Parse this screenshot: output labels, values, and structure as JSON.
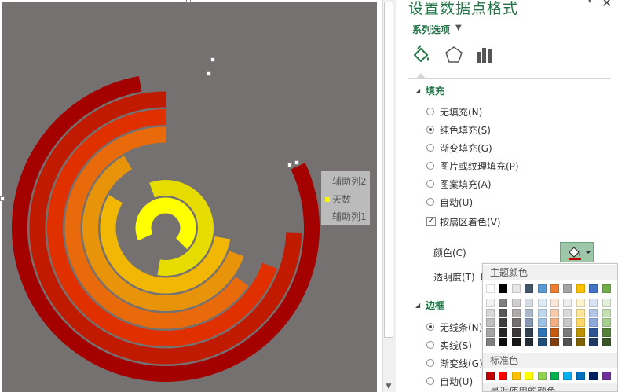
{
  "pane": {
    "title": "设置数据点格式",
    "series_options": "系列选项",
    "tabs": [
      "fill-line-icon",
      "effects-icon",
      "series-options-icon"
    ],
    "fill_section": "填充",
    "fill_options": [
      {
        "label": "无填充(N)",
        "selected": false
      },
      {
        "label": "纯色填充(S)",
        "selected": true
      },
      {
        "label": "渐变填充(G)",
        "selected": false
      },
      {
        "label": "图片或纹理填充(P)",
        "selected": false
      },
      {
        "label": "图案填充(A)",
        "selected": false
      },
      {
        "label": "自动(U)",
        "selected": false
      }
    ],
    "vary_by_sector": "按扇区着色(V)",
    "vary_checked": true,
    "color_label": "颜色(C)",
    "transparency_label": "透明度(T)",
    "border_section": "边框",
    "border_options": [
      {
        "label": "无线条(N)",
        "selected": true
      },
      {
        "label": "实线(S)",
        "selected": false
      },
      {
        "label": "渐变线(G)",
        "selected": false
      },
      {
        "label": "自动(U)",
        "selected": false
      }
    ]
  },
  "palette": {
    "theme_head": "主题颜色",
    "standard_head": "标准色",
    "recent_head": "最近使用的颜色",
    "theme_top": [
      "#ffffff",
      "#000000",
      "#e7e6e6",
      "#44546a",
      "#5b9bd5",
      "#ed7d31",
      "#a5a5a5",
      "#ffc000",
      "#4472c4",
      "#70ad47"
    ],
    "theme_shades": [
      [
        "#f2f2f2",
        "#7f7f7f",
        "#d0cece",
        "#d6dce4",
        "#deebf6",
        "#fbe5d5",
        "#ededed",
        "#fff2cc",
        "#d9e2f3",
        "#e2efd9"
      ],
      [
        "#d8d8d8",
        "#595959",
        "#aeabab",
        "#adb9ca",
        "#bdd7ee",
        "#f7cbac",
        "#dbdbdb",
        "#fee599",
        "#b4c6e7",
        "#c5e0b3"
      ],
      [
        "#bfbfbf",
        "#3f3f3f",
        "#757070",
        "#8496b0",
        "#9cc3e5",
        "#f4b083",
        "#c9c9c9",
        "#ffd965",
        "#8eaadb",
        "#a8d08d"
      ],
      [
        "#a5a5a5",
        "#262626",
        "#3a3838",
        "#323f4f",
        "#2e75b5",
        "#c55a11",
        "#7b7b7b",
        "#bf9000",
        "#2f5496",
        "#538135"
      ],
      [
        "#7f7f7f",
        "#0c0c0c",
        "#171616",
        "#222a35",
        "#1e4e79",
        "#833c0b",
        "#525252",
        "#7f6000",
        "#1f3864",
        "#375623"
      ]
    ],
    "standard": [
      "#c00000",
      "#ff0000",
      "#ffc000",
      "#ffff00",
      "#92d050",
      "#00b050",
      "#00b0f0",
      "#0070c0",
      "#002060",
      "#7030a0"
    ]
  },
  "legend": {
    "items": [
      {
        "label": "辅助列2",
        "color": ""
      },
      {
        "label": "天数",
        "color": "#ffff00"
      },
      {
        "label": "辅助列1",
        "color": ""
      }
    ]
  },
  "chart_data": {
    "type": "doughnut",
    "colors": [
      "#a50000",
      "#c01a00",
      "#e03000",
      "#e86a0a",
      "#e8940a",
      "#f2b705",
      "#e6dc00",
      "#ffff00"
    ],
    "rings_visible_segment_degrees": [
      [
        -10,
        195
      ],
      [
        0,
        178
      ],
      [
        0,
        160
      ],
      [
        0,
        145
      ],
      [
        -30,
        130
      ],
      [
        -60,
        110
      ],
      [
        -170,
        120
      ],
      [
        -225,
        160
      ]
    ]
  },
  "colors": {
    "accent": "#217346",
    "plot_bg": "#767171"
  }
}
